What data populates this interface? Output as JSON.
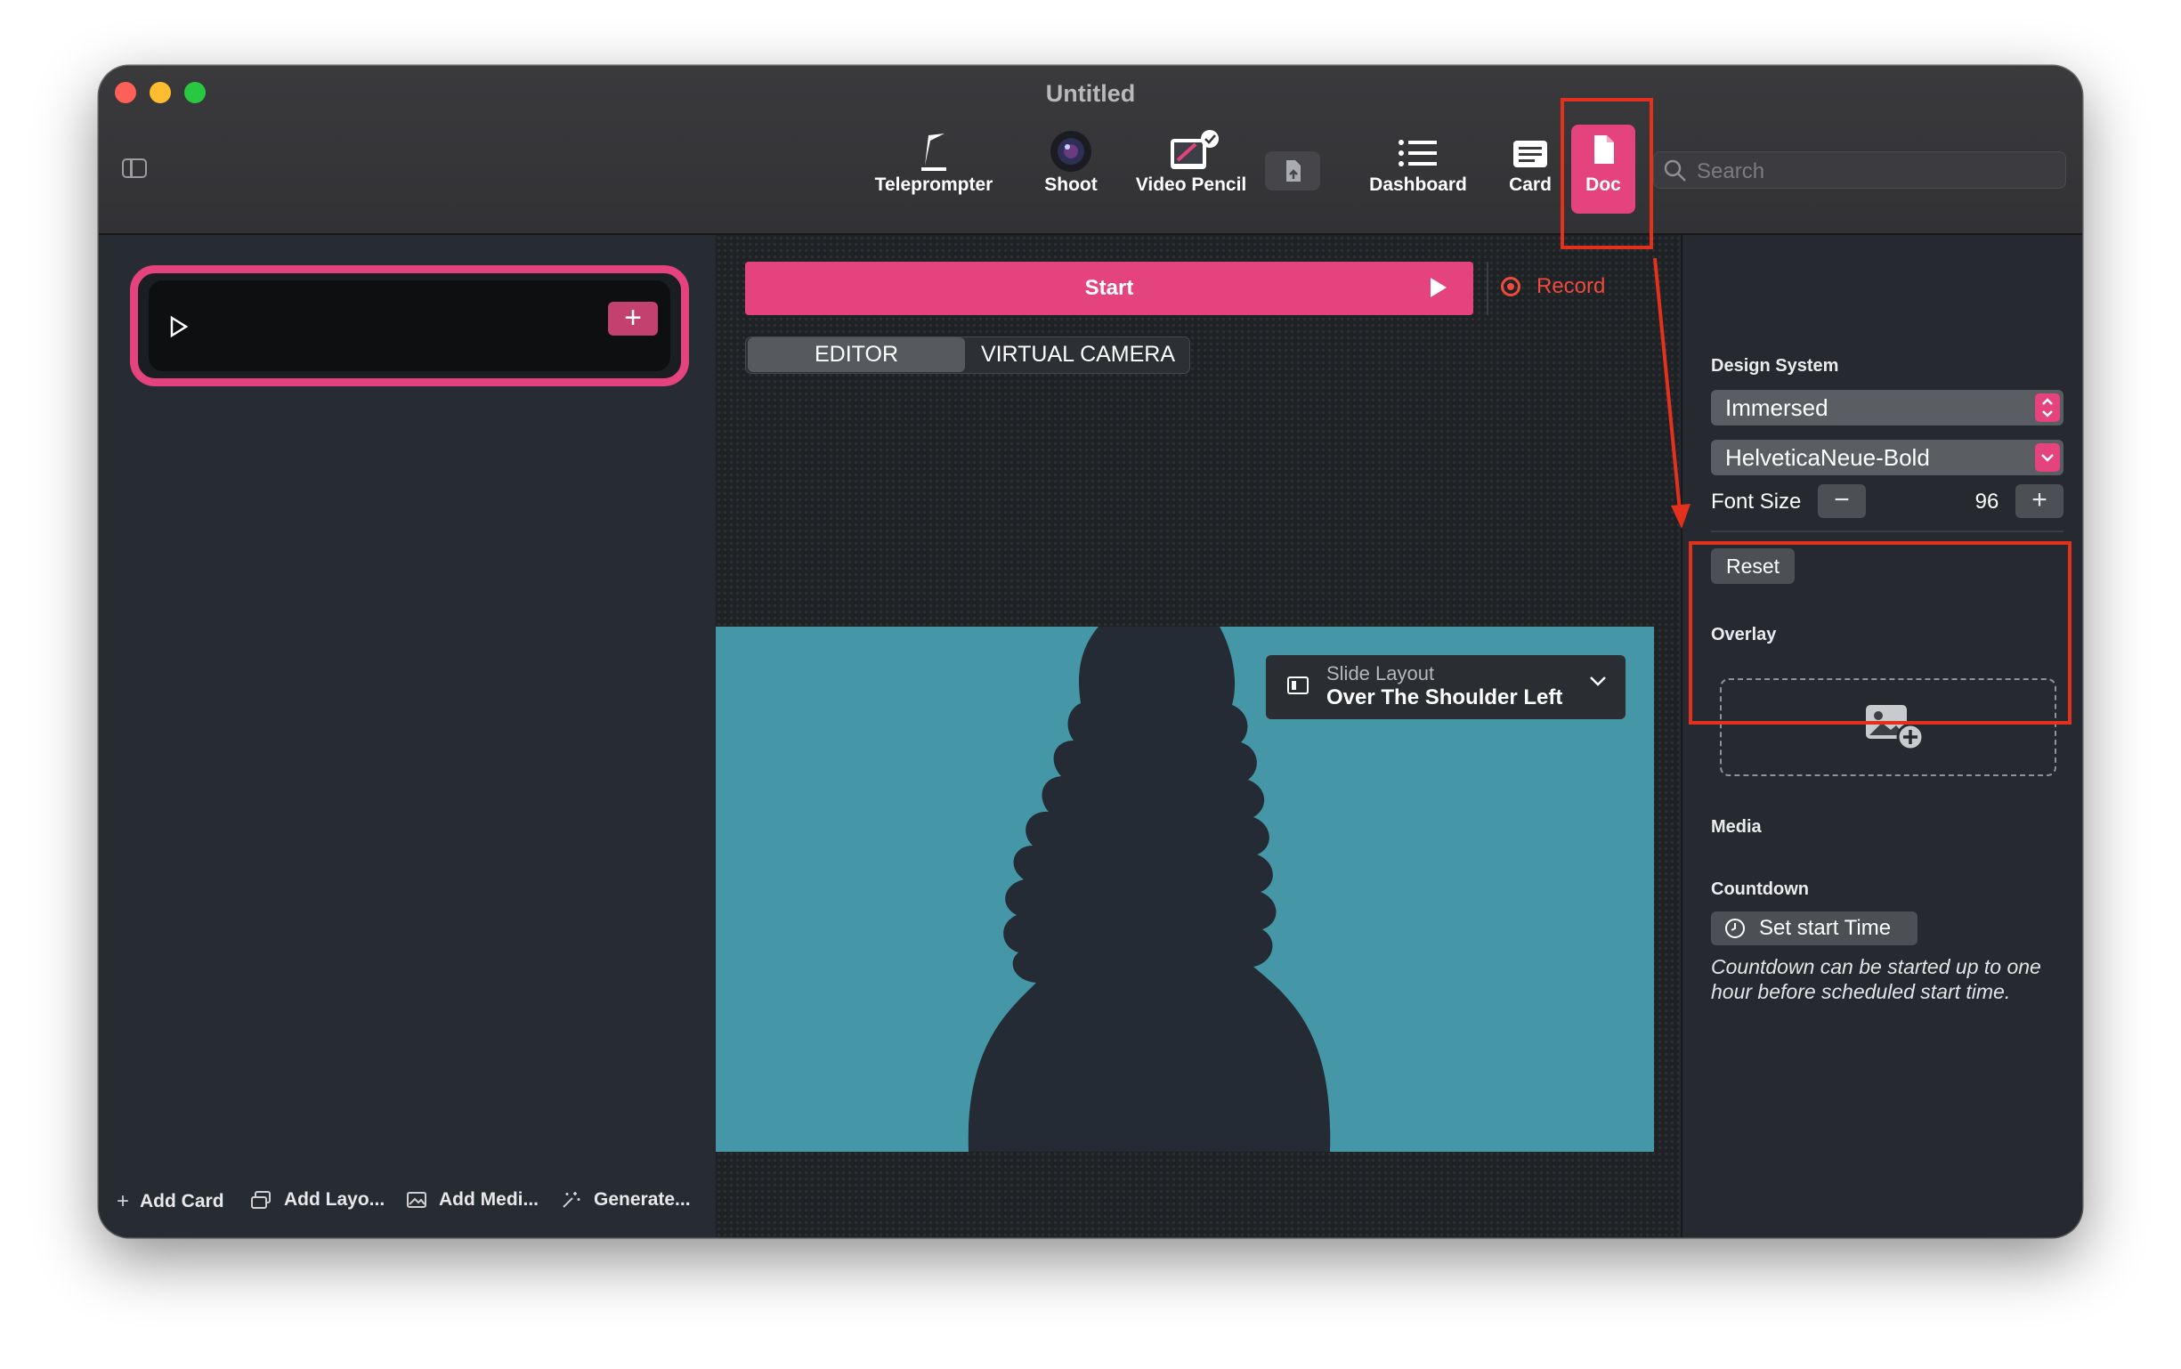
{
  "window": {
    "title": "Untitled"
  },
  "toolbar": {
    "items": [
      {
        "label": "Teleprompter",
        "icon": "teleprompter-icon"
      },
      {
        "label": "Shoot",
        "icon": "camera-lens-icon"
      },
      {
        "label": "Video Pencil",
        "icon": "video-pencil-icon"
      },
      {
        "label": "",
        "icon": "document-badge-icon"
      },
      {
        "label": "Dashboard",
        "icon": "list-icon"
      },
      {
        "label": "Card",
        "icon": "card-icon"
      },
      {
        "label": "Doc",
        "icon": "doc-icon",
        "active": true
      }
    ],
    "search_placeholder": "Search"
  },
  "sidebar": {
    "bottom_actions": [
      {
        "label": "Add Card",
        "icon": "plus-icon"
      },
      {
        "label": "Add Layo...",
        "icon": "layout-icon"
      },
      {
        "label": "Add Medi...",
        "icon": "media-icon"
      },
      {
        "label": "Generate...",
        "icon": "sparkle-icon"
      }
    ],
    "card_add": "+"
  },
  "center": {
    "start_label": "Start",
    "record_label": "Record",
    "tabs": [
      {
        "label": "EDITOR",
        "active": true
      },
      {
        "label": "VIRTUAL CAMERA",
        "active": false
      }
    ],
    "slide_layout": {
      "label": "Slide Layout",
      "value": "Over The Shoulder Left"
    }
  },
  "inspector": {
    "design_system_heading": "Design System",
    "design_system_value": "Immersed",
    "font_value": "HelveticaNeue-Bold",
    "font_size_label": "Font Size",
    "font_size_value": "96",
    "minus": "−",
    "plus": "+",
    "reset_label": "Reset",
    "overlay_heading": "Overlay",
    "media_heading": "Media",
    "countdown_heading": "Countdown",
    "countdown_button": "Set start Time",
    "countdown_note": "Countdown can be started up to one hour before scheduled start time."
  },
  "colors": {
    "accent": "#e5437e",
    "annotation": "#e3311d",
    "stage": "#4597a7",
    "silhouette": "#242b35"
  }
}
